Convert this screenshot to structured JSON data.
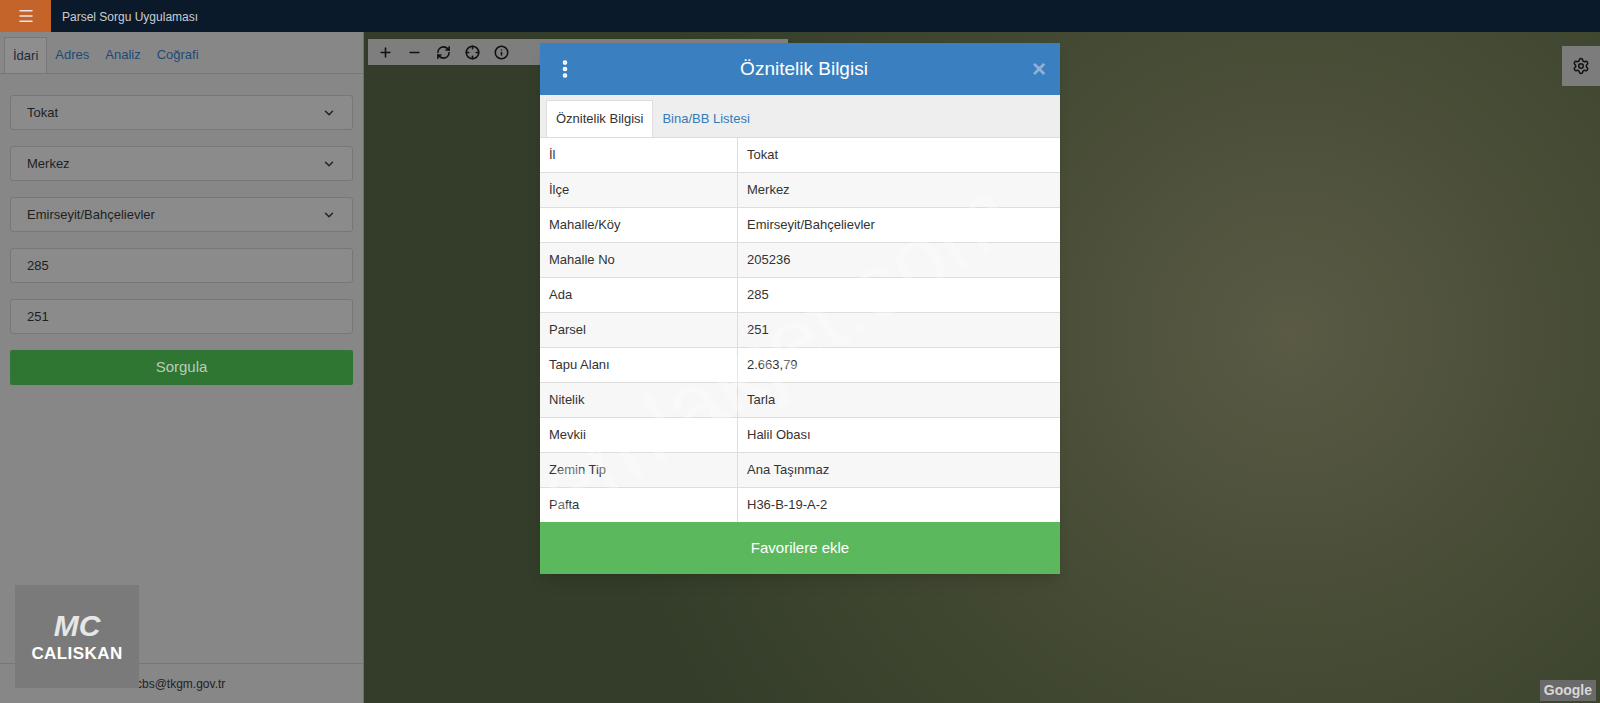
{
  "app": {
    "title": "Parsel Sorgu Uygulaması"
  },
  "sidebar": {
    "tabs": [
      {
        "label": "İdari",
        "selected": true
      },
      {
        "label": "Adres",
        "selected": false
      },
      {
        "label": "Analiz",
        "selected": false
      },
      {
        "label": "Coğrafi",
        "selected": false
      }
    ],
    "fields": [
      {
        "kind": "select",
        "value": "Tokat"
      },
      {
        "kind": "select",
        "value": "Merkez"
      },
      {
        "kind": "select",
        "value": "Emirseyit/Bahçelievler"
      },
      {
        "kind": "input",
        "value": "285"
      },
      {
        "kind": "input",
        "value": "251"
      }
    ],
    "submit": "Sorgula",
    "footer_email": "cbs@tkgm.gov.tr"
  },
  "map": {
    "watermark": "emlakjet.com",
    "attribution": "Google"
  },
  "logo": {
    "mark": "MC",
    "name": "CALISKAN"
  },
  "dialog": {
    "title": "Öznitelik Bilgisi",
    "close": "×",
    "tabs": [
      {
        "label": "Öznitelik Bilgisi",
        "selected": true
      },
      {
        "label": "Bina/BB Listesi",
        "selected": false
      }
    ],
    "rows": [
      {
        "label": "İl",
        "value": "Tokat"
      },
      {
        "label": "İlçe",
        "value": "Merkez"
      },
      {
        "label": "Mahalle/Köy",
        "value": "Emirseyit/Bahçelievler"
      },
      {
        "label": "Mahalle No",
        "value": "205236"
      },
      {
        "label": "Ada",
        "value": "285"
      },
      {
        "label": "Parsel",
        "value": "251"
      },
      {
        "label": "Tapu Alanı",
        "value": "2.663,79"
      },
      {
        "label": "Nitelik",
        "value": "Tarla"
      },
      {
        "label": "Mevkii",
        "value": "Halil Obası"
      },
      {
        "label": "Zemin Tip",
        "value": "Ana Taşınmaz"
      },
      {
        "label": "Pafta",
        "value": "H36-B-19-A-2"
      }
    ],
    "button": "Favorilere ekle"
  }
}
